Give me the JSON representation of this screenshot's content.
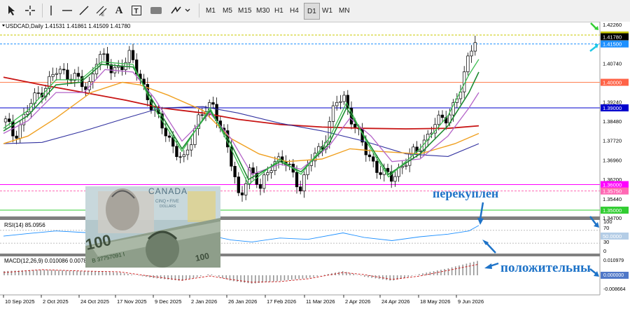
{
  "toolbar": {
    "tools": [
      "cursor-icon",
      "crosshair-icon",
      "vertical-line-icon",
      "horizontal-line-icon",
      "trendline-icon",
      "channel-icon",
      "text-icon",
      "label-icon",
      "shapes-icon",
      "arrows-icon"
    ],
    "timeframes": [
      "M1",
      "M5",
      "M15",
      "M30",
      "H1",
      "H4",
      "D1",
      "W1",
      "MN"
    ],
    "active_timeframe": "D1"
  },
  "chart": {
    "header": "USDCAD,Daily  1.41531 1.41861 1.41509 1.41780",
    "symbol": "USDCAD",
    "price_scale": [
      "1.42260",
      "1.40740",
      "1.39240",
      "1.38480",
      "1.37720",
      "1.36960",
      "1.36200",
      "1.35440",
      "1.34700"
    ],
    "price_tags": [
      {
        "value": "1.41850",
        "color": "#c8c800"
      },
      {
        "value": "1.41780",
        "color": "#000000"
      },
      {
        "value": "1.41500",
        "color": "#1e90ff"
      },
      {
        "value": "1.40000",
        "color": "#ff6347"
      },
      {
        "value": "1.39000",
        "color": "#0000cd"
      },
      {
        "value": "1.36000",
        "color": "#ff00ff"
      },
      {
        "value": "1.35750",
        "color": "#ff69b4"
      },
      {
        "value": "1.35000",
        "color": "#32cd32"
      }
    ],
    "rsi_label": "RSI(14) 85.0956",
    "rsi_scale": [
      "100",
      "70",
      "30",
      "0"
    ],
    "rsi_tag": "50.0000",
    "macd_label": "MACD(12,26,9) 0.010086 0.00789",
    "macd_scale": [
      "0.010979",
      "0.000000",
      "-0.008664"
    ],
    "dates": [
      "10 Sep 2025",
      "2 Oct 2025",
      "24 Oct 2025",
      "17 Nov 2025",
      "9 Dec 2025",
      "2 Jan 2026",
      "26 Jan 2026",
      "17 Feb 2026",
      "11 Mar 2026",
      "2 Apr 2026",
      "24 Apr 2026",
      "18 May 2026",
      "9 Jun 2026"
    ]
  },
  "annotations": {
    "overbought": "перекуплен",
    "positive": "положительны"
  },
  "banknote": {
    "country": "CANADA",
    "subtitle": "CINQ • FIVE",
    "subtitle2": "DOLLARS",
    "serial": "B 37757091 I"
  },
  "colors": {
    "ma_red": "#c81414",
    "ma_orange": "#f0a020",
    "ma_navy": "#3232a0",
    "ma_violet": "#b464c8",
    "ma_green": "#1e8c32",
    "ma_lime": "#3cbe50",
    "rsi_line": "#1e90ff",
    "macd_hist": "#969696",
    "macd_signal": "#c81414",
    "annotation": "#1e73c8"
  }
}
